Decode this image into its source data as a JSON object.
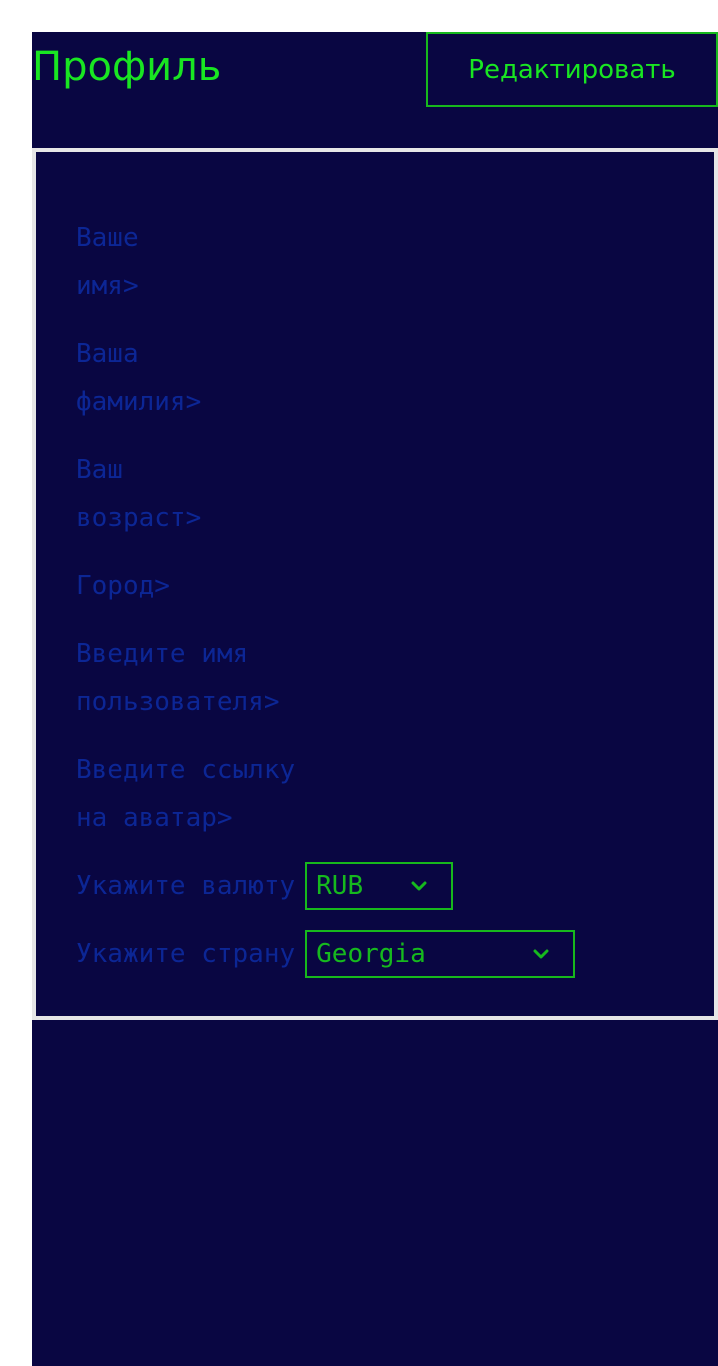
{
  "header": {
    "title": "Профиль",
    "edit_label": "Редактировать"
  },
  "form": {
    "first_name": [
      "Ваше",
      "имя>"
    ],
    "last_name": [
      "Ваша",
      "фамилия>"
    ],
    "age": [
      "Ваш",
      "возраст>"
    ],
    "city": [
      "Город>"
    ],
    "username": [
      "Введите имя",
      "пользователя>"
    ],
    "avatar": [
      "Введите ссылку",
      "на аватар>"
    ],
    "currency": {
      "label": "Укажите валюту",
      "value": "RUB"
    },
    "country": {
      "label": "Укажите страну",
      "value": "Georgia"
    }
  },
  "icons": {
    "dropdown": "chevron-down-icon"
  },
  "colors": {
    "background": "#090642",
    "accent": "#19e622",
    "muted_text": "#0c2695",
    "panel_border": "#e6e6e6"
  }
}
